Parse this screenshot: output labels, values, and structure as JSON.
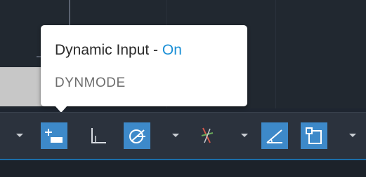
{
  "tooltip": {
    "title": "Dynamic Input - ",
    "status": "On",
    "command": "DYNMODE"
  },
  "statusbar": {
    "buttons": [
      {
        "name": "dynamic-input",
        "icon": "dynamic-input-icon",
        "active": true
      },
      {
        "name": "ortho-mode",
        "icon": "ortho-icon",
        "active": false
      },
      {
        "name": "polar-tracking",
        "icon": "polar-tracking-icon",
        "active": true
      },
      {
        "name": "object-snap-tracking",
        "icon": "object-snap-tracking-icon",
        "active": false
      },
      {
        "name": "dynamic-ucs",
        "icon": "dynamic-ucs-icon",
        "active": true
      },
      {
        "name": "selection-cycling",
        "icon": "selection-cycling-icon",
        "active": true
      }
    ]
  },
  "colors": {
    "accent": "#3d89c9",
    "tooltip_status": "#1a8fd6",
    "statusbar_bg": "#2b323d"
  }
}
